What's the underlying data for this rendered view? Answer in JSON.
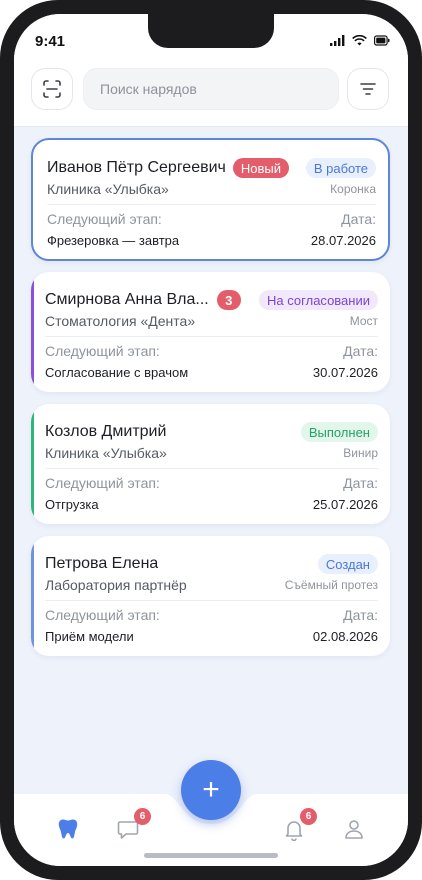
{
  "status_bar": {
    "time": "9:41"
  },
  "top_bar": {
    "scan_icon": "scan-icon",
    "search": {
      "value": "",
      "placeholder": "Поиск нарядов"
    },
    "filter_icon": "filter-icon"
  },
  "orders": [
    {
      "name": "Иванов Пётр Сергеевич",
      "new_badge": "Новый",
      "status": "В работе",
      "clinic": "Клиника «Улыбка»",
      "product": "Коронка",
      "next_stage_label": "Следующий этап:",
      "next_stage": "Фрезеровка — завтра",
      "date_label": "Дата:",
      "date": "28.07.2026",
      "accent_color": "#5f86d6",
      "status_bg": "#e8f0fd",
      "status_color": "#4a78d8"
    },
    {
      "name": "Смирнова Анна Вла...",
      "count_badge": "3",
      "status": "На согласовании",
      "clinic": "Стоматология «Дента»",
      "product": "Мост",
      "next_stage_label": "Следующий этап:",
      "next_stage": "Согласование с врачом",
      "date_label": "Дата:",
      "date": "30.07.2026",
      "accent_color": "#8a4fdc",
      "status_bg": "#f1e8fc",
      "status_color": "#7c45cf"
    },
    {
      "name": "Козлов Дмитрий",
      "status": "Выполнен",
      "clinic": "Клиника «Улыбка»",
      "product": "Винир",
      "next_stage_label": "Следующий этап:",
      "next_stage": "Отгрузка",
      "date_label": "Дата:",
      "date": "25.07.2026",
      "accent_color": "#2fb57a",
      "status_bg": "#e3f6ec",
      "status_color": "#26a165"
    },
    {
      "name": "Петрова Елена",
      "status": "Создан",
      "clinic": "Лаборатория партнёр",
      "product": "Съёмный протез",
      "next_stage_label": "Следующий этап:",
      "next_stage": "Приём модели",
      "date_label": "Дата:",
      "date": "02.08.2026",
      "accent_color": "#6f93df",
      "status_bg": "#e8f0fd",
      "status_color": "#4a78d8"
    }
  ],
  "bottom_nav": {
    "fab_label": "+",
    "items": [
      {
        "icon": "tooth-icon",
        "active": true
      },
      {
        "icon": "chat-icon",
        "badge": "6"
      },
      {
        "icon": "bell-icon",
        "badge": "6"
      },
      {
        "icon": "profile-icon"
      }
    ]
  },
  "colors": {
    "new_badge": "#e35d6a",
    "count_badge": "#e35d6a",
    "accent": "#4c7ee8"
  }
}
